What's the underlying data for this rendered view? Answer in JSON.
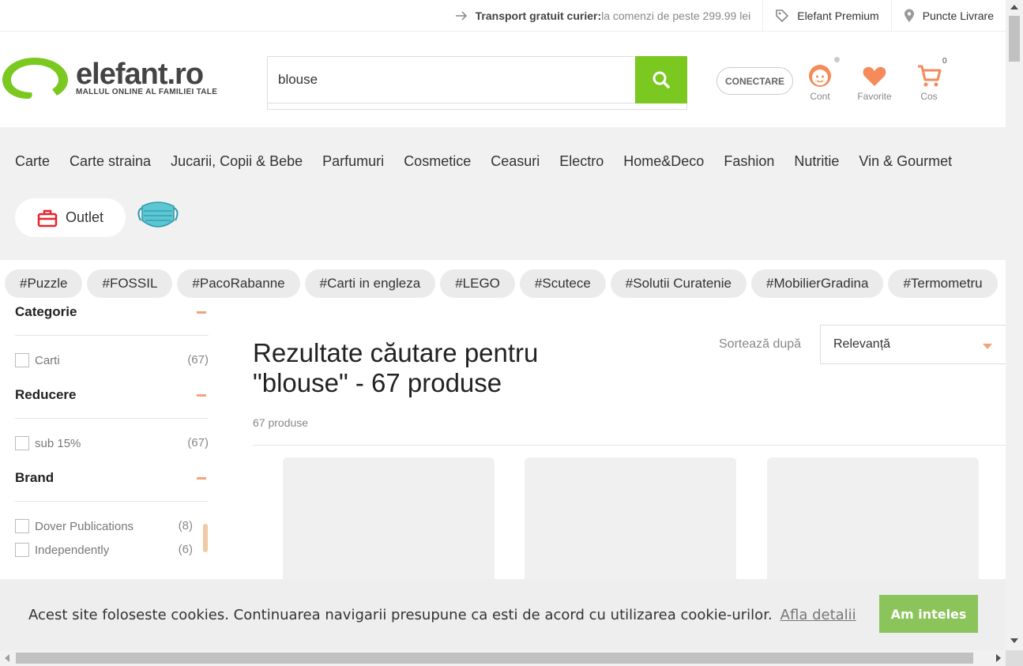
{
  "topbar": {
    "shipping_bold": "Transport gratuit curier:",
    "shipping_rest": " la comenzi de peste 299.99 lei",
    "premium": "Elefant Premium",
    "pickup": "Puncte Livrare"
  },
  "logo": {
    "name": "elefant.ro",
    "tagline": "MALLUL ONLINE AL FAMILIEI TALE"
  },
  "search": {
    "value": "blouse"
  },
  "header": {
    "login": "CONECTARE",
    "account": "Cont",
    "favorites": "Favorite",
    "cart": "Cos",
    "cart_count": "0"
  },
  "nav": {
    "items": [
      "Carte",
      "Carte straina",
      "Jucarii, Copii & Bebe",
      "Parfumuri",
      "Cosmetice",
      "Ceasuri",
      "Electro",
      "Home&Deco",
      "Fashion",
      "Nutritie",
      "Vin & Gourmet"
    ],
    "outlet": "Outlet"
  },
  "tags": [
    "#Puzzle",
    "#FOSSIL",
    "#PacoRabanne",
    "#Carti in engleza",
    "#LEGO",
    "#Scutece",
    "#Solutii Curatenie",
    "#MobilierGradina",
    "#Termometru"
  ],
  "filters": {
    "category": {
      "title": "Categorie",
      "items": [
        {
          "label": "Carti",
          "count": "(67)"
        }
      ]
    },
    "discount": {
      "title": "Reducere",
      "items": [
        {
          "label": "sub 15%",
          "count": "(67)"
        }
      ]
    },
    "brand": {
      "title": "Brand",
      "items": [
        {
          "label": "Dover Publications",
          "count": "(8)"
        },
        {
          "label": "Independently",
          "count": "(6)"
        }
      ]
    }
  },
  "results": {
    "title_line1": "Rezultate căutare pentru",
    "title_line2": "\"blouse\" - 67 produse",
    "count": "67 produse",
    "sort_label": "Sortează după",
    "sort_value": "Relevanță"
  },
  "cookie": {
    "text": "Acest site foloseste cookies. Continuarea navigarii presupune ca esti de acord cu utilizarea cookie-urilor.",
    "link": "Afla detalii",
    "button": "Am inteles"
  },
  "colors": {
    "brand_green": "#7bc820",
    "accent_orange": "#f5a27a",
    "icon_orange": "#f58a5a"
  }
}
